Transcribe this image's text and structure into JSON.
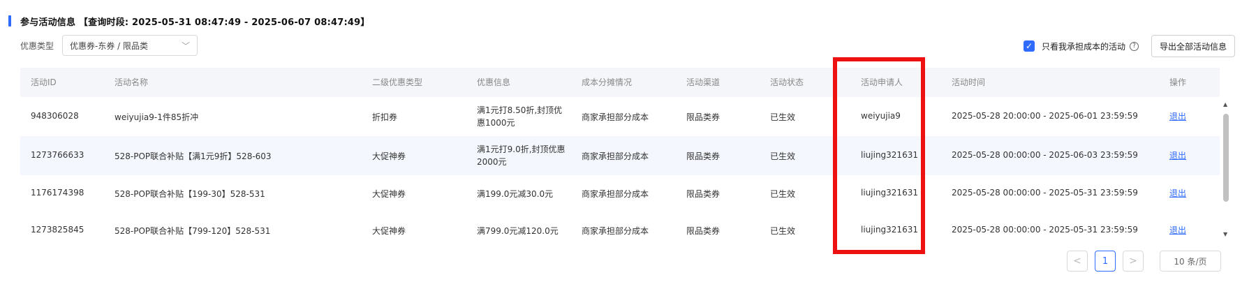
{
  "section": {
    "title": "参与活动信息 【查询时段: 2025-05-31 08:47:49 - 2025-06-07 08:47:49】"
  },
  "filter": {
    "label": "优惠类型",
    "value": "优惠券-东券 / 限品类"
  },
  "controls": {
    "checkbox_checked": true,
    "checkbox_label": "只看我承担成本的活动",
    "export_label": "导出全部活动信息"
  },
  "table": {
    "headers": [
      "活动ID",
      "活动名称",
      "二级优惠类型",
      "优惠信息",
      "成本分摊情况",
      "活动渠道",
      "活动状态",
      "活动申请人",
      "活动时间",
      "操作"
    ],
    "rows": [
      {
        "id": "948306028",
        "name": "weiyujia9-1件85折冲",
        "type": "折扣券",
        "info": "满1元打8.50折,封顶优惠1000元",
        "cost": "商家承担部分成本",
        "channel": "限品类券",
        "status": "已生效",
        "applicant": "weiyujia9",
        "time": "2025-05-28 20:00:00 - 2025-06-01 23:59:59",
        "action": "退出"
      },
      {
        "id": "1273766633",
        "name": "528-POP联合补贴【满1元9折】528-603",
        "type": "大促神券",
        "info": "满1元打9.0折,封顶优惠2000元",
        "cost": "商家承担部分成本",
        "channel": "限品类券",
        "status": "已生效",
        "applicant": "liujing321631",
        "time": "2025-05-28 00:00:00 - 2025-06-03 23:59:59",
        "action": "退出"
      },
      {
        "id": "1176174398",
        "name": "528-POP联合补贴【199-30】528-531",
        "type": "大促神券",
        "info": "满199.0元减30.0元",
        "cost": "商家承担部分成本",
        "channel": "限品类券",
        "status": "已生效",
        "applicant": "liujing321631",
        "time": "2025-05-28 00:00:00 - 2025-05-31 23:59:59",
        "action": "退出"
      },
      {
        "id": "1273825845",
        "name": "528-POP联合补贴【799-120】528-531",
        "type": "大促神券",
        "info": "满799.0元减120.0元",
        "cost": "商家承担部分成本",
        "channel": "限品类券",
        "status": "已生效",
        "applicant": "liujing321631",
        "time": "2025-05-28 00:00:00 - 2025-05-31 23:59:59",
        "action": "退出"
      }
    ]
  },
  "pagination": {
    "prev": "<",
    "page": "1",
    "next": ">",
    "page_size": "10 条/页"
  },
  "colors": {
    "accent": "#2f6bff",
    "highlight": "#ee1111"
  }
}
